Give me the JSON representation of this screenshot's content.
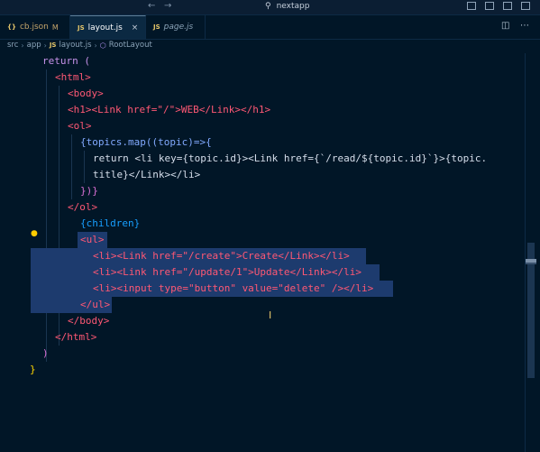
{
  "titlebar": {
    "back_arrow": "←",
    "forward_arrow": "→",
    "search_text": "nextapp"
  },
  "tabs": [
    {
      "label": "cb.json",
      "icon_text": "{}",
      "icon_color": "#e6c66a",
      "modified": "M",
      "active": false,
      "italic": false
    },
    {
      "label": "layout.js",
      "icon_text": "JS",
      "icon_color": "#e6c66a",
      "close": "×",
      "active": true,
      "italic": false
    },
    {
      "label": "page.js",
      "icon_text": "JS",
      "icon_color": "#e6c66a",
      "active": false,
      "italic": true
    }
  ],
  "breadcrumb": {
    "parts": [
      "src",
      "app",
      "layout.js",
      "RootLayout"
    ],
    "file_icon": "JS",
    "symbol_icon": "⬡"
  },
  "editor": {
    "lines": [
      "return (",
      "<html>",
      "<body>",
      "<h1><Link href=\"/\">WEB</Link></h1>",
      "<ol>",
      "{topics.map((topic)=>{",
      "return <li key={topic.id}><Link href={`/read/${topic.id}`}>{topic.",
      "title}</Link></li>",
      "})}",
      "</ol>",
      "{children}",
      "<ul>",
      "<li><Link href=\"/create\">Create</Link></li>",
      "<li><Link href=\"/update/1\">Update</Link></li>",
      "<li><input type=\"button\" value=\"delete\" /></li>",
      "</ul>",
      "</body>",
      "</html>",
      ")",
      "}"
    ]
  },
  "colors": {
    "background": "#011627",
    "selection": "#1d3b6e",
    "keyword": "#c792ea",
    "tag": "#ff5874",
    "attribute": "#addb67",
    "string": "#ecc48d"
  }
}
